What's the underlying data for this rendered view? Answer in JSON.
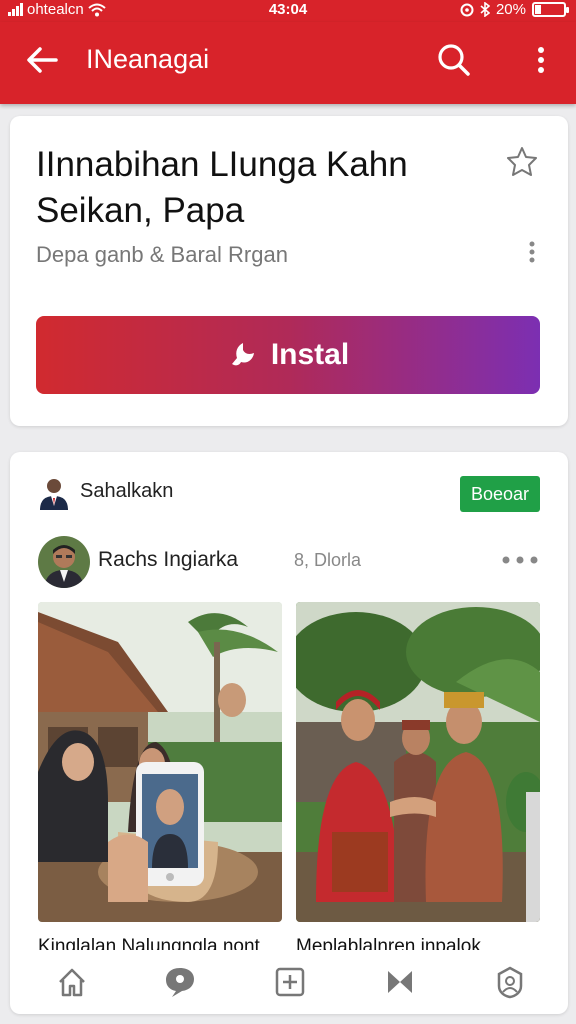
{
  "status_bar": {
    "carrier": "ohtealcn",
    "time": "43:04",
    "battery": "20%",
    "battery_level": 0.2
  },
  "app_bar": {
    "title": "INeanagai"
  },
  "app_card": {
    "title": "IInnabihan LIunga Kahn Seikan, Papa",
    "developer": "Depa ganb & Baral Rrgan",
    "install_label": "Instal",
    "install_gradient": [
      "#d12a2f",
      "#7c2fb2"
    ]
  },
  "recommendation": {
    "label": "Sahalkakn",
    "badge": "Boeoar",
    "badge_color": "#20a047"
  },
  "post": {
    "author": "Rachs Ingiarka",
    "meta": "8, Dlorla",
    "captions": [
      "Kinglalan Nalungngla nont",
      "Meplablalnren inpalok"
    ]
  },
  "bottom_nav": {
    "items": [
      "home-icon",
      "chat-icon",
      "add-icon",
      "video-icon",
      "profile-icon"
    ]
  },
  "colors": {
    "brand_red": "#d8232a",
    "install_purple": "#7c2fb2",
    "badge_green": "#20a047"
  }
}
